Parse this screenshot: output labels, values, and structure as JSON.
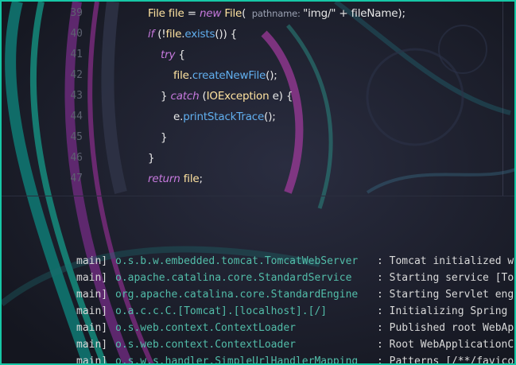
{
  "editor": {
    "lines": [
      {
        "num": "39",
        "indent": 0,
        "tokens": [
          {
            "t": "File",
            "c": "typ"
          },
          {
            "t": " ",
            "c": "plain"
          },
          {
            "t": "file",
            "c": "var"
          },
          {
            "t": " = ",
            "c": "plain"
          },
          {
            "t": "new",
            "c": "kw"
          },
          {
            "t": " ",
            "c": "plain"
          },
          {
            "t": "File",
            "c": "typ"
          },
          {
            "t": "( ",
            "c": "punc"
          },
          {
            "t": " pathname: ",
            "c": "hint"
          },
          {
            "t": "\"img/\"",
            "c": "str"
          },
          {
            "t": " + ",
            "c": "plain"
          },
          {
            "t": "fileName",
            "c": "plain"
          },
          {
            "t": ");",
            "c": "punc"
          }
        ]
      },
      {
        "num": "40",
        "indent": 0,
        "tokens": [
          {
            "t": "if",
            "c": "kw"
          },
          {
            "t": " (!",
            "c": "punc"
          },
          {
            "t": "file",
            "c": "var"
          },
          {
            "t": ".",
            "c": "punc"
          },
          {
            "t": "exists",
            "c": "fn"
          },
          {
            "t": "()) {",
            "c": "punc"
          }
        ]
      },
      {
        "num": "41",
        "indent": 1,
        "tokens": [
          {
            "t": "try",
            "c": "kw"
          },
          {
            "t": " {",
            "c": "punc"
          }
        ]
      },
      {
        "num": "42",
        "indent": 2,
        "tokens": [
          {
            "t": "file",
            "c": "var"
          },
          {
            "t": ".",
            "c": "punc"
          },
          {
            "t": "createNewFile",
            "c": "fn"
          },
          {
            "t": "();",
            "c": "punc"
          }
        ]
      },
      {
        "num": "43",
        "indent": 1,
        "tokens": [
          {
            "t": "} ",
            "c": "punc"
          },
          {
            "t": "catch",
            "c": "kw"
          },
          {
            "t": " (",
            "c": "punc"
          },
          {
            "t": "IOException",
            "c": "typ"
          },
          {
            "t": " e) {",
            "c": "punc"
          }
        ]
      },
      {
        "num": "44",
        "indent": 2,
        "tokens": [
          {
            "t": "e",
            "c": "plain"
          },
          {
            "t": ".",
            "c": "punc"
          },
          {
            "t": "printStackTrace",
            "c": "fn"
          },
          {
            "t": "();",
            "c": "punc"
          }
        ]
      },
      {
        "num": "45",
        "indent": 1,
        "tokens": [
          {
            "t": "}",
            "c": "punc"
          }
        ]
      },
      {
        "num": "46",
        "indent": 0,
        "tokens": [
          {
            "t": "}",
            "c": "punc"
          }
        ]
      },
      {
        "num": "47",
        "indent": 0,
        "tokens": [
          {
            "t": "return",
            "c": "kw"
          },
          {
            "t": " ",
            "c": "plain"
          },
          {
            "t": "file",
            "c": "var"
          },
          {
            "t": ";",
            "c": "punc"
          }
        ]
      }
    ]
  },
  "console": {
    "lines": [
      {
        "thread": "main]",
        "logger": "o.s.b.w.embedded.tomcat.TomcatWebServer",
        "message": ": Tomcat initialized w"
      },
      {
        "thread": "main]",
        "logger": "o.apache.catalina.core.StandardService",
        "message": ": Starting service [To"
      },
      {
        "thread": "main]",
        "logger": "org.apache.catalina.core.StandardEngine",
        "message": ": Starting Servlet eng"
      },
      {
        "thread": "main]",
        "logger": "o.a.c.c.C.[Tomcat].[localhost].[/]",
        "message": ": Initializing Spring"
      },
      {
        "thread": "main]",
        "logger": "o.s.web.context.ContextLoader",
        "message": ": Published root WebAp"
      },
      {
        "thread": "main]",
        "logger": "o.s.web.context.ContextLoader",
        "message": ": Root WebApplicationC"
      },
      {
        "thread": "main]",
        "logger": "o.s.w.s.handler.SimpleUrlHandlerMapping",
        "message": ": Patterns [/**/favico"
      }
    ]
  },
  "colors": {
    "frame": "#16c7a6",
    "background": "#1a1c2a",
    "keyword": "#c679dd",
    "type": "#ffe3a0",
    "method": "#61afef",
    "logger": "#52bda9"
  }
}
